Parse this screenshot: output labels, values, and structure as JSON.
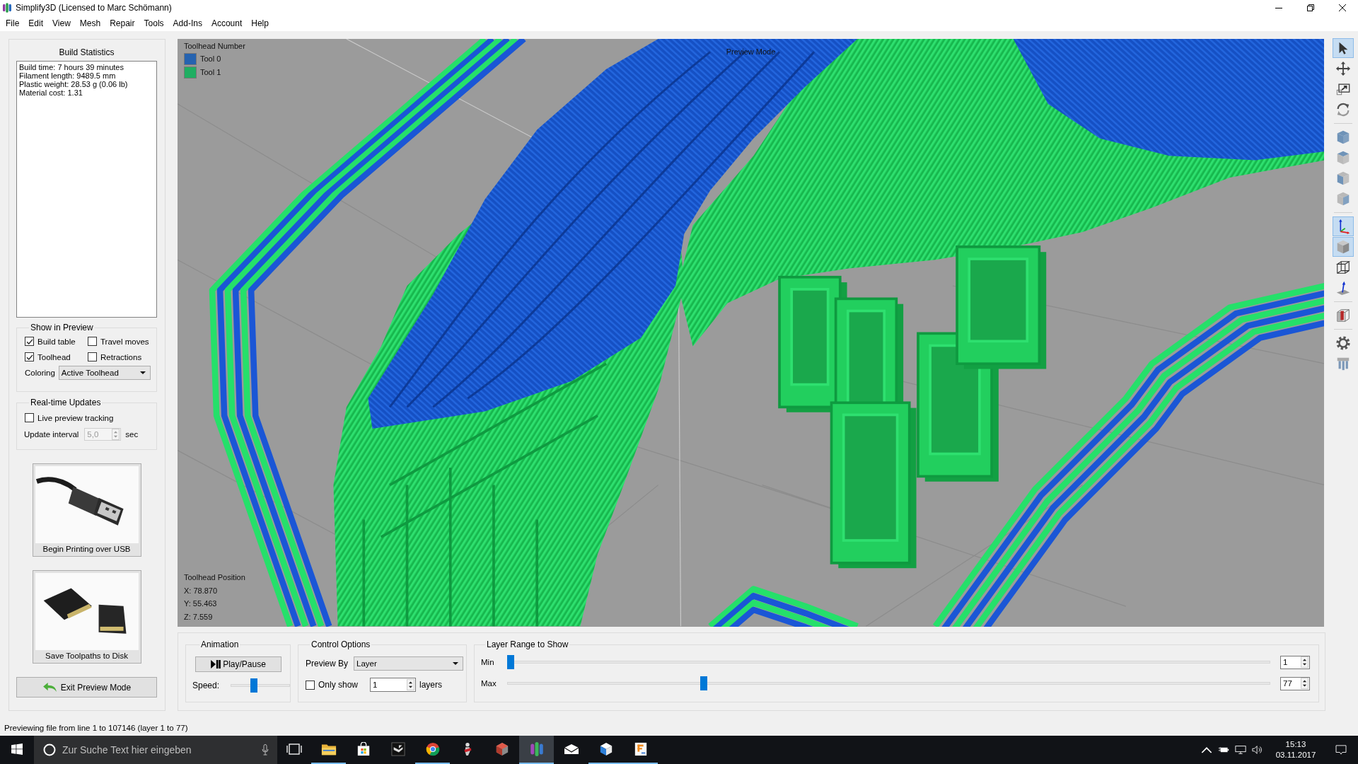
{
  "window": {
    "title": "Simplify3D (Licensed to Marc Schömann)"
  },
  "menu": [
    "File",
    "Edit",
    "View",
    "Mesh",
    "Repair",
    "Tools",
    "Add-Ins",
    "Account",
    "Help"
  ],
  "build_statistics": {
    "title": "Build Statistics",
    "lines": [
      "Build time: 7 hours 39 minutes",
      "Filament length: 9489.5 mm",
      "Plastic weight: 28.53 g (0.06 lb)",
      "Material cost: 1.31"
    ]
  },
  "show_in_preview": {
    "title": "Show in Preview",
    "options": [
      {
        "label": "Build table",
        "checked": true
      },
      {
        "label": "Travel moves",
        "checked": false
      },
      {
        "label": "Toolhead",
        "checked": true
      },
      {
        "label": "Retractions",
        "checked": false
      }
    ],
    "coloring": {
      "label": "Coloring",
      "value": "Active Toolhead"
    }
  },
  "realtime_updates": {
    "title": "Real-time Updates",
    "live_tracking": {
      "label": "Live preview tracking",
      "checked": false
    },
    "update_interval": {
      "label": "Update interval",
      "value": "5,0",
      "disabled": true,
      "unit": "sec"
    }
  },
  "action_buttons": [
    {
      "kind": "usb",
      "label": "Begin Printing over USB"
    },
    {
      "kind": "disk",
      "label": "Save Toolpaths to Disk"
    }
  ],
  "exit_button": {
    "label": "Exit Preview Mode"
  },
  "viewport": {
    "mode_label": "Preview Mode",
    "legend": {
      "title": "Toolhead Number",
      "items": [
        {
          "label": "Tool 0",
          "color": "#2563b0"
        },
        {
          "label": "Tool 1",
          "color": "#1fae62"
        }
      ]
    },
    "position": {
      "title": "Toolhead Position",
      "lines": [
        "X: 78.870",
        "Y: 55.463",
        "Z: 7.559"
      ]
    }
  },
  "toolbar": [
    [
      {
        "kind": "select",
        "selected": true
      },
      {
        "kind": "move",
        "selected": false
      },
      {
        "kind": "scale",
        "selected": false
      },
      {
        "kind": "rotate",
        "selected": false
      }
    ],
    [
      {
        "kind": "view-iso",
        "selected": false
      },
      {
        "kind": "view-top",
        "selected": false
      },
      {
        "kind": "view-front",
        "selected": false
      },
      {
        "kind": "view-side",
        "selected": false
      }
    ],
    [
      {
        "kind": "axes",
        "selected": true
      },
      {
        "kind": "solid",
        "selected": true
      },
      {
        "kind": "wireframe",
        "selected": false
      },
      {
        "kind": "normals",
        "selected": false
      }
    ],
    [
      {
        "kind": "section",
        "selected": false
      }
    ],
    [
      {
        "kind": "settings",
        "selected": false
      },
      {
        "kind": "supports",
        "selected": false
      }
    ]
  ],
  "animation": {
    "title": "Animation",
    "play_button": "Play/Pause",
    "speed": {
      "label": "Speed:",
      "level": 0.38
    }
  },
  "control_options": {
    "title": "Control Options",
    "preview_by": {
      "label": "Preview By",
      "value": "Layer"
    },
    "only_show": {
      "label": "Only show",
      "checked": false,
      "value": "1",
      "unit": "layers"
    }
  },
  "layer_range": {
    "title": "Layer Range to Show",
    "sliders": [
      {
        "label": "Min",
        "level": 0,
        "value": "1"
      },
      {
        "label": "Max",
        "level": 0.255,
        "value": "77"
      }
    ]
  },
  "status_bar": "Previewing file from line 1 to 107146 (layer 1 to 77)",
  "taskbar": {
    "search_placeholder": "Zur Suche Text hier eingeben",
    "apps": [
      {
        "kind": "folder",
        "selected": false,
        "running": true
      },
      {
        "kind": "bag",
        "selected": false,
        "running": false
      },
      {
        "kind": "tile",
        "selected": false,
        "running": false
      },
      {
        "kind": "circle",
        "selected": false,
        "running": true
      },
      {
        "kind": "figure",
        "selected": false,
        "running": false
      },
      {
        "kind": "gem",
        "selected": false,
        "running": false
      },
      {
        "kind": "stripes",
        "selected": true,
        "running": true
      },
      {
        "kind": "mail",
        "selected": false,
        "running": false
      },
      {
        "kind": "cube",
        "selected": false,
        "running": true
      },
      {
        "kind": "letter",
        "selected": false,
        "running": true
      }
    ],
    "time": "15:13",
    "date": "03.11.2017"
  }
}
